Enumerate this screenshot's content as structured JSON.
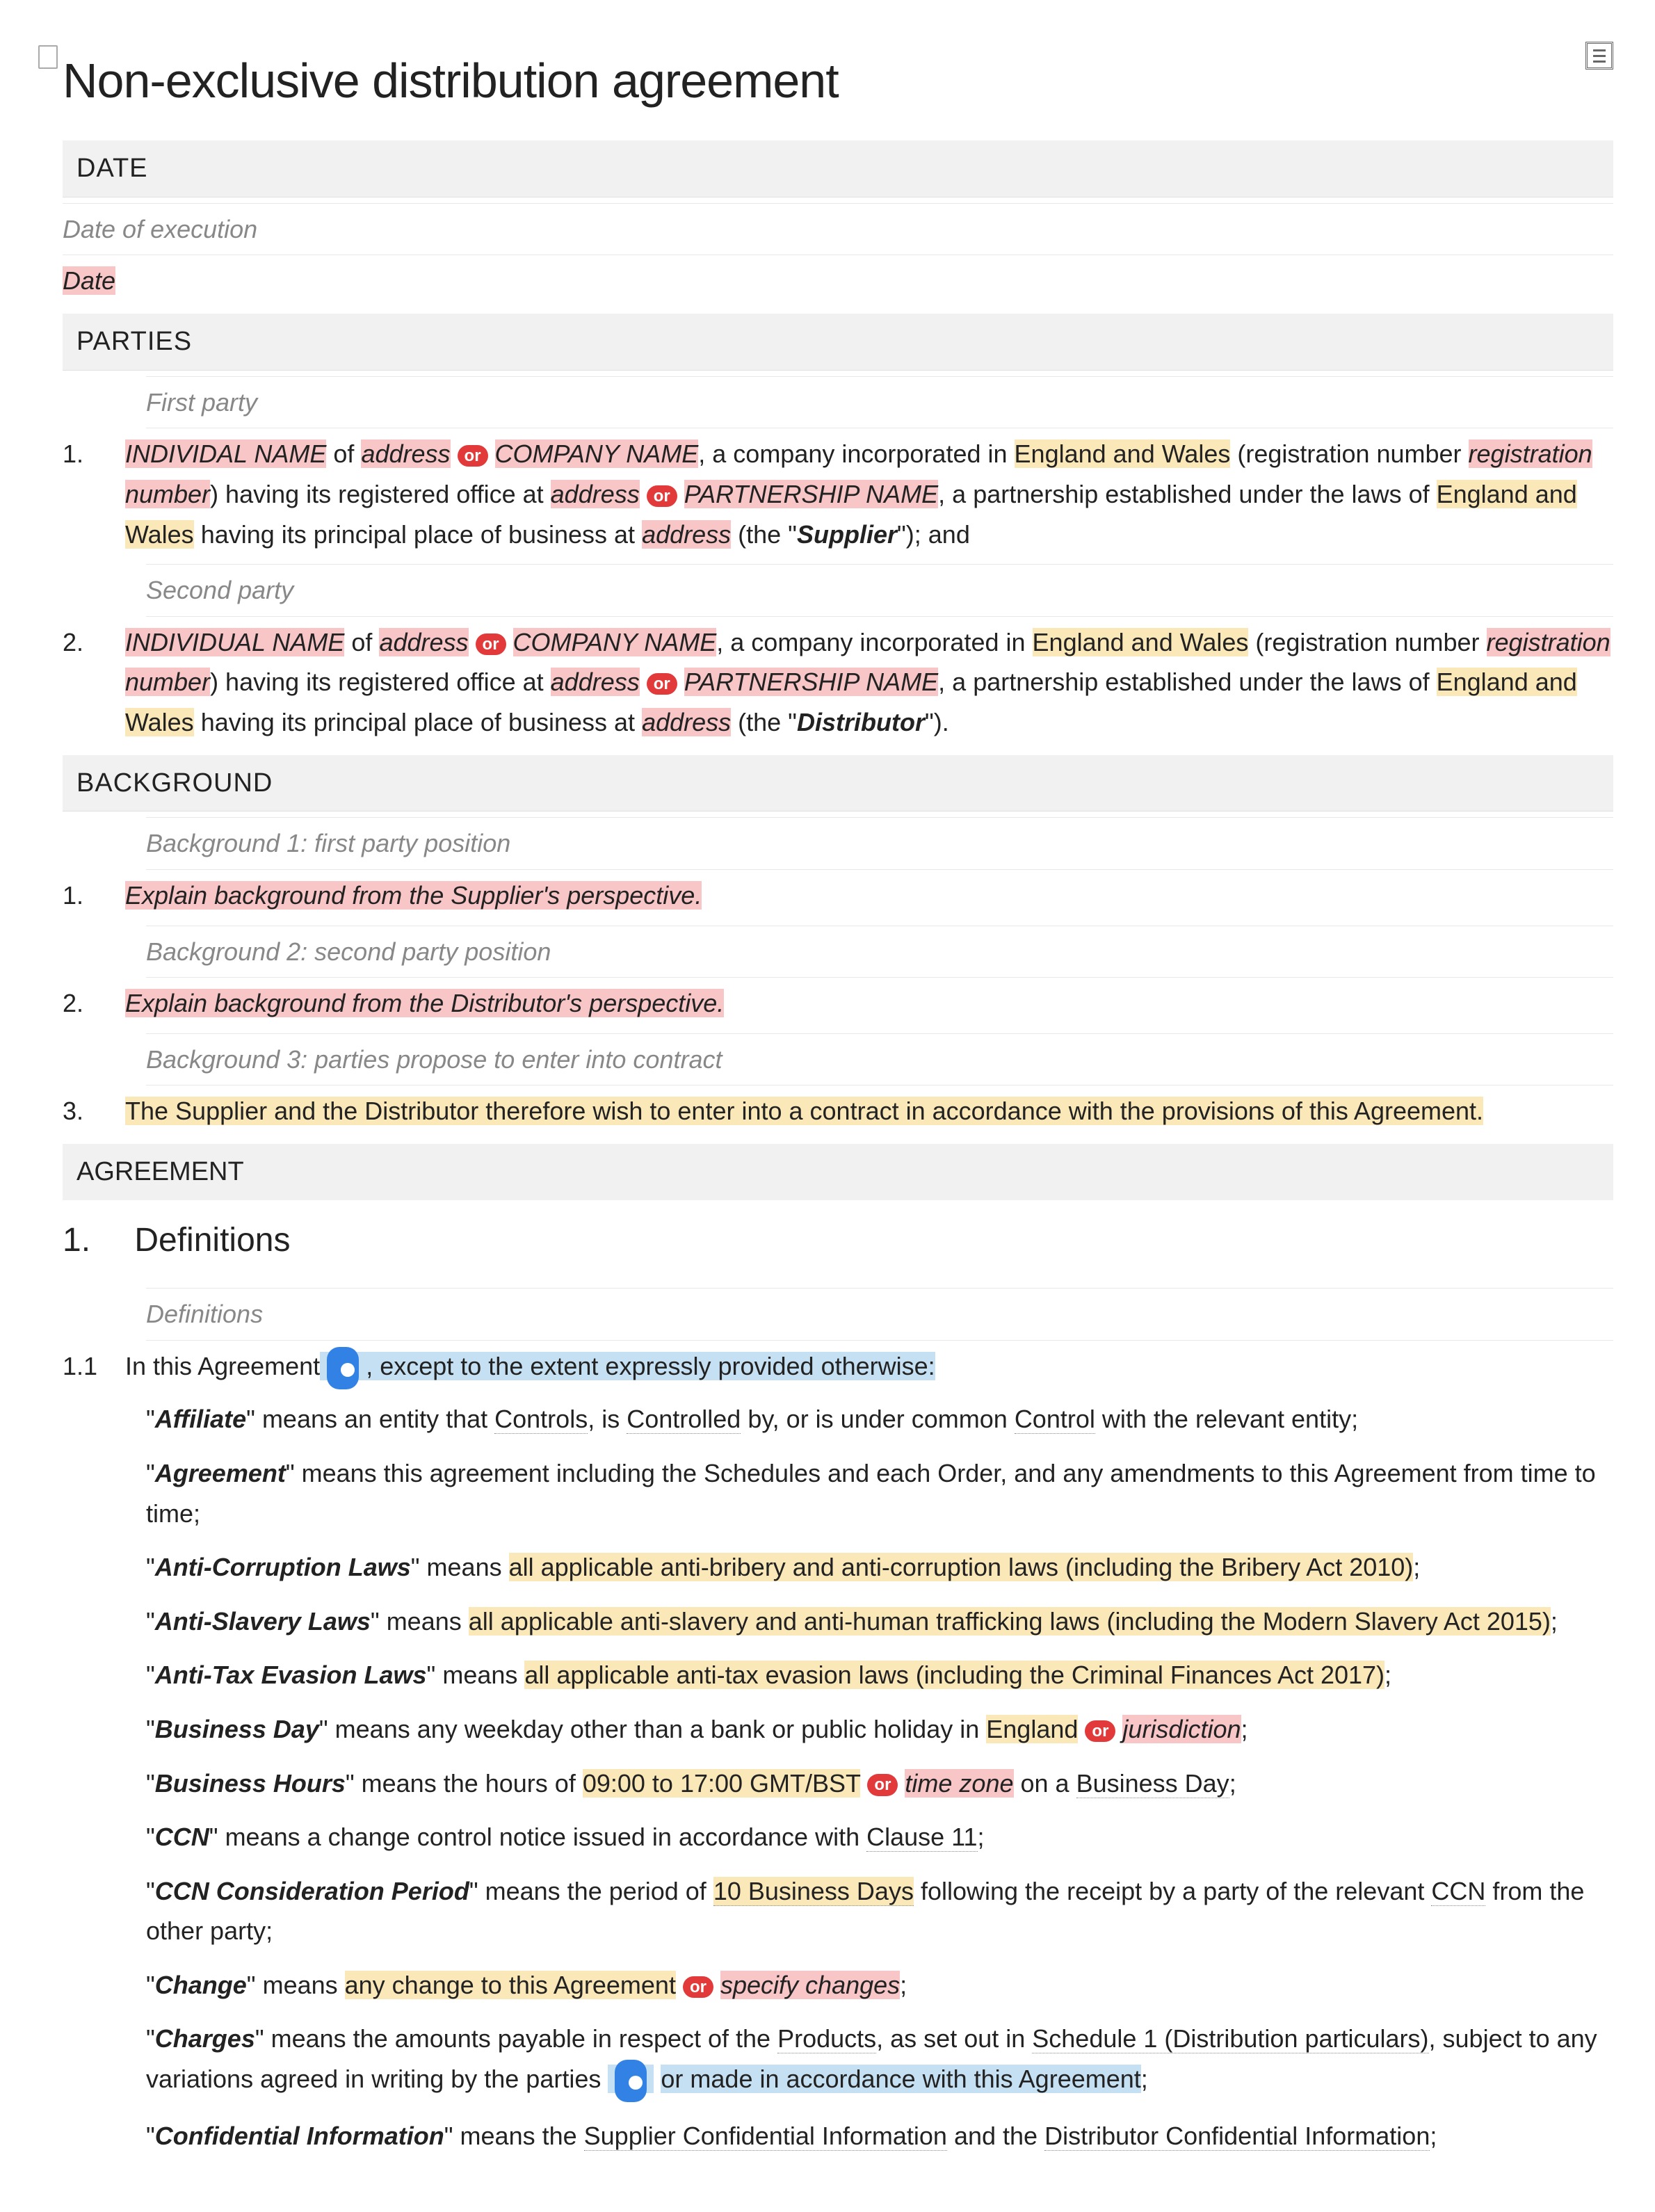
{
  "title": "Non-exclusive distribution agreement",
  "sections": {
    "date": {
      "header": "DATE",
      "sub": "Date of execution",
      "value": "Date"
    },
    "parties": {
      "header": "PARTIES",
      "first_sub": "First party",
      "second_sub": "Second party",
      "p1": {
        "num": "1.",
        "indname": "INDIVIDAL NAME",
        "of": " of ",
        "addr": "address",
        "or": "or",
        "comp": "COMPANY NAME",
        "incorp": ", a company incorporated in ",
        "ew": "England and Wales",
        "reg_open": " (registration number ",
        "regnum": "registration number",
        "reg_close": ") having its registered office at ",
        "addr2": "address",
        "or2": "or",
        "partname": "PARTNERSHIP NAME",
        "part": ", a partnership established under the laws of ",
        "ew2": "England and Wales",
        "ppb": " having its principal place of business at ",
        "addr3": "address",
        "the_open": " (the \"",
        "role": "Supplier",
        "the_close": "\"); and"
      },
      "p2": {
        "num": "2.",
        "role": "Distributor",
        "the_close": "\")."
      }
    },
    "background": {
      "header": "BACKGROUND",
      "b1": {
        "sub": "Background 1: first party position",
        "num": "1.",
        "text": "Explain background from the Supplier's perspective."
      },
      "b2": {
        "sub": "Background 2: second party position",
        "num": "2.",
        "text": "Explain background from the Distributor's perspective."
      },
      "b3": {
        "sub": "Background 3: parties propose to enter into contract",
        "num": "3.",
        "text": "The Supplier and the Distributor therefore wish to enter into a contract in accordance with the provisions of this Agreement."
      }
    },
    "agreement": {
      "header": "AGREEMENT",
      "section_num": "1.",
      "section_title": "Definitions",
      "sub": "Definitions",
      "clause_num": "1.1"
    }
  },
  "or": "or",
  "defs": {
    "intro_pre": "In this Agreement",
    "intro_post": ", except to the extent expressly provided otherwise:",
    "affiliate": {
      "term": "Affiliate",
      "t1": "\" means an entity that ",
      "controls": "Controls",
      "t2": ", is ",
      "controlled": "Controlled",
      "t3": " by, or is under common ",
      "control": "Control",
      "t4": " with the relevant entity;"
    },
    "agreement": {
      "term": "Agreement",
      "text": "\" means this agreement including the Schedules and each Order, and any amendments to this Agreement from time to time;"
    },
    "anticorr": {
      "term": "Anti-Corruption Laws",
      "pre": "\" means ",
      "hl": "all applicable anti-bribery and anti-corruption laws (including the Bribery Act 2010)",
      "post": ";"
    },
    "antislavery": {
      "term": "Anti-Slavery Laws",
      "pre": "\" means ",
      "hl": "all applicable anti-slavery and anti-human trafficking laws (including the Modern Slavery Act 2015)",
      "post": ";"
    },
    "antitax": {
      "term": "Anti-Tax Evasion Laws",
      "pre": "\" means ",
      "hl": "all applicable anti-tax evasion laws (including the Criminal Finances Act 2017)",
      "post": ";"
    },
    "bday": {
      "term": "Business Day",
      "pre": "\" means any weekday other than a bank or public holiday in ",
      "eng": "England",
      "juris": "jurisdiction",
      "post": ";"
    },
    "bhours": {
      "term": "Business Hours",
      "pre": "\" means the hours of ",
      "time": "09:00 to 17:00 GMT/BST",
      "tz": "time zone",
      "on": " on a ",
      "bd": "Business Day",
      "post": ";"
    },
    "ccn": {
      "term": "CCN",
      "pre": "\" means a change control notice issued in accordance with ",
      "cl": "Clause 11",
      "post": ";"
    },
    "ccncp": {
      "term": "CCN Consideration Period",
      "pre": "\" means the period of ",
      "days": "10 Business Days",
      "mid": " following the receipt by a party of the relevant ",
      "link": "CCN",
      "post": " from the other party;"
    },
    "change": {
      "term": "Change",
      "pre": "\" means ",
      "hl": "any change to this Agreement",
      "spec": "specify changes",
      "post": ";"
    },
    "charges": {
      "term": "Charges",
      "pre": "\" means the amounts payable in respect of the ",
      "prod": "Products",
      "mid": ", as set out in ",
      "sched": "Schedule 1 (Distribution particulars)",
      "mid2": ", subject to any variations agreed in writing by the parties ",
      "hl": "or made in accordance with this Agreement",
      "post": ";"
    },
    "confinfo": {
      "term": "Confidential Information",
      "pre": "\" means the ",
      "sci": "Supplier Confidential Information",
      "and": " and the ",
      "dci": "Distributor Confidential Information",
      "post": ";"
    }
  }
}
